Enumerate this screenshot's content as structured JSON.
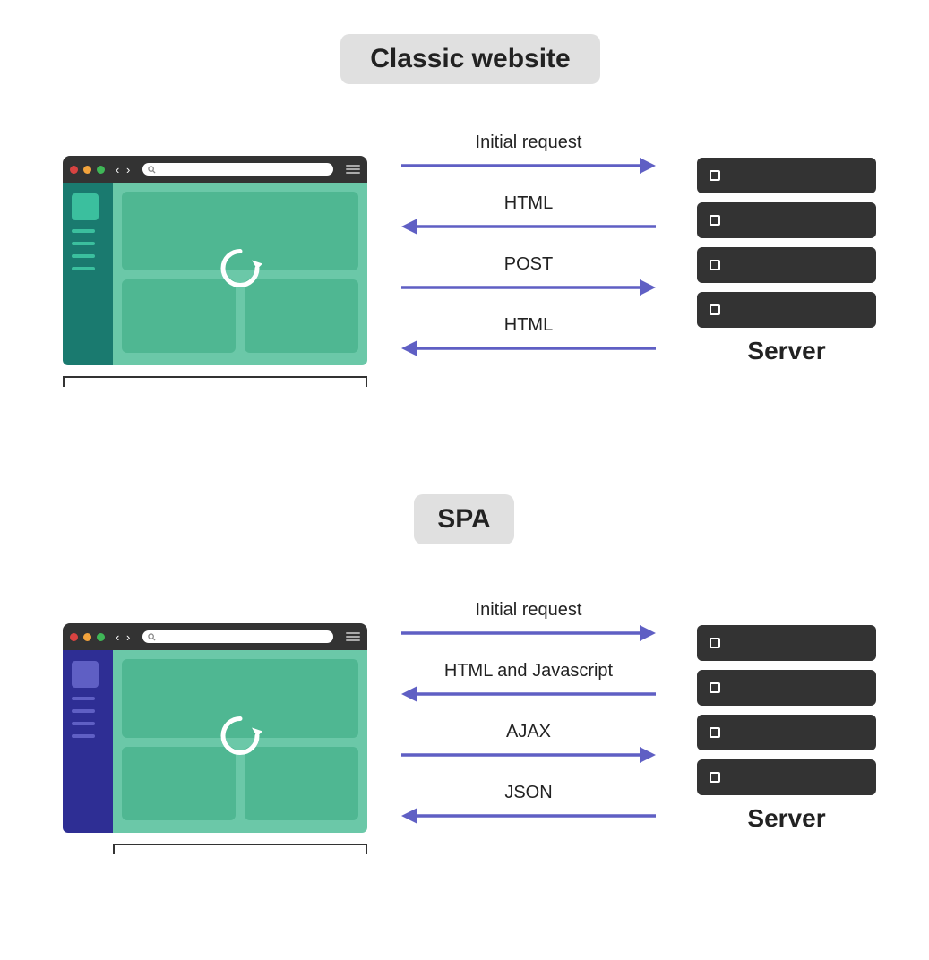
{
  "diagram": {
    "sections": [
      {
        "title": "Classic website",
        "browser_theme": "teal",
        "server_label": "Server",
        "arrows": [
          {
            "label": "Initial request",
            "direction": "right"
          },
          {
            "label": "HTML",
            "direction": "left"
          },
          {
            "label": "POST",
            "direction": "right"
          },
          {
            "label": "HTML",
            "direction": "left"
          }
        ]
      },
      {
        "title": "SPA",
        "browser_theme": "indigo",
        "server_label": "Server",
        "arrows": [
          {
            "label": "Initial request",
            "direction": "right"
          },
          {
            "label": "HTML and Javascript",
            "direction": "left"
          },
          {
            "label": "AJAX",
            "direction": "right"
          },
          {
            "label": "JSON",
            "direction": "left"
          }
        ]
      }
    ],
    "colors": {
      "arrow": "#5f5fc4",
      "content_bg": "#6bc8a8",
      "panel_bg": "#4fb792",
      "classic_sidebar": "#1a7a6f",
      "spa_sidebar": "#2e2e94",
      "server_bg": "#333333",
      "title_bg": "#e0e0e0"
    }
  }
}
